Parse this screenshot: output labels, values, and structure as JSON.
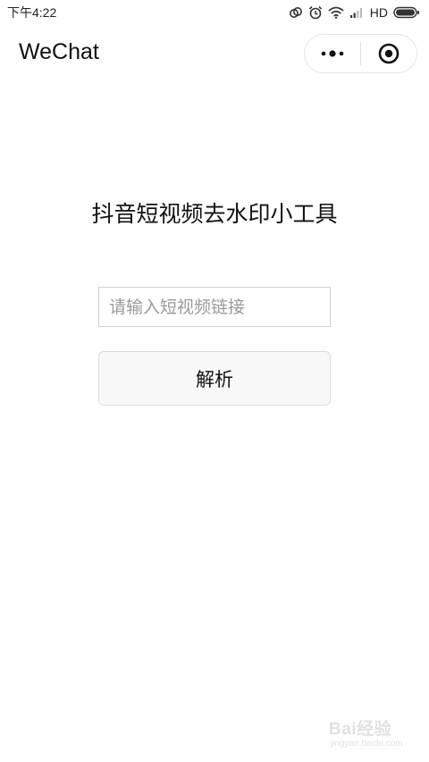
{
  "status_bar": {
    "time": "下午4:22",
    "network": "HD",
    "icons": [
      "sync-icon",
      "alarm-icon",
      "wifi-icon",
      "signal-icon",
      "battery-icon"
    ]
  },
  "nav": {
    "title": "WeChat",
    "menu_icon": "more-dots-icon",
    "close_icon": "target-circle-icon"
  },
  "main": {
    "heading": "抖音短视频去水印小工具",
    "input_value": "",
    "input_placeholder": "请输入短视频链接",
    "parse_button_label": "解析"
  },
  "watermark": {
    "brand": "Bai经验",
    "url": "jingyan.baidu.com"
  }
}
